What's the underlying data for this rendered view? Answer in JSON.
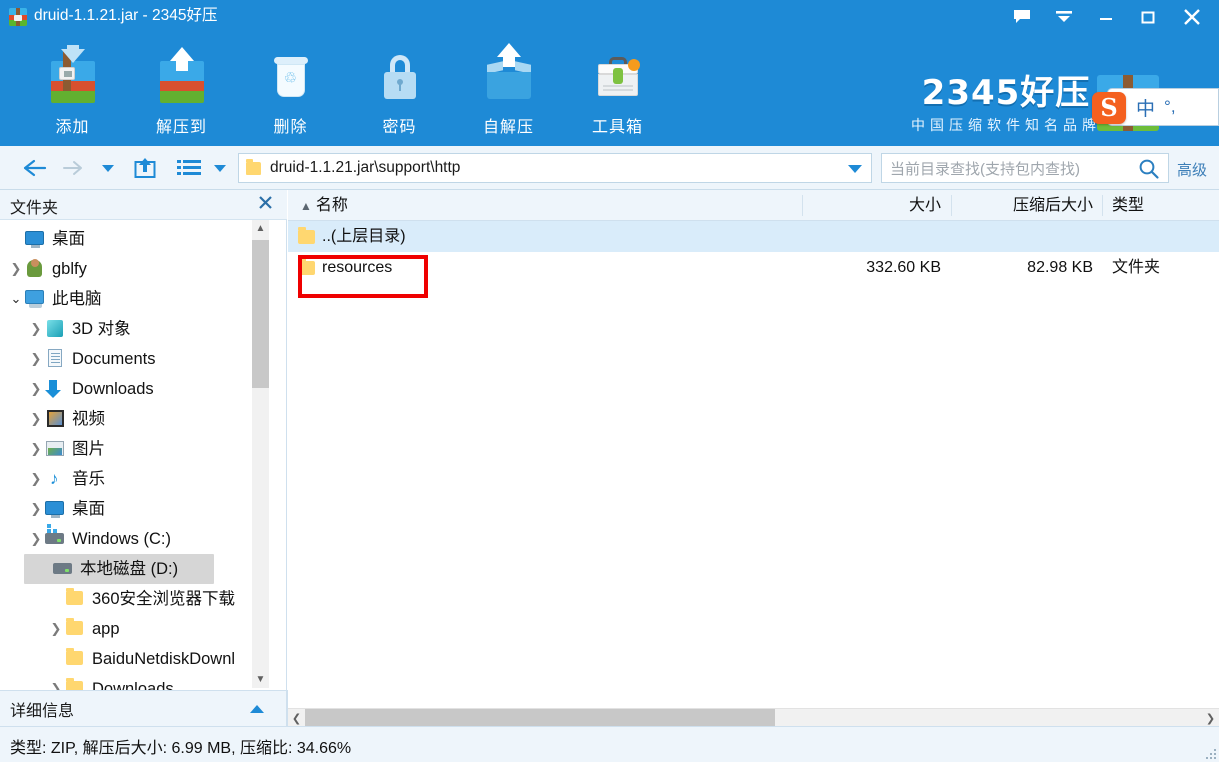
{
  "titlebar": {
    "title": "druid-1.1.21.jar - 2345好压",
    "app_icon": "archive-icon",
    "buttons": [
      {
        "name": "feedback-button",
        "icon": "speech-bubble-icon"
      },
      {
        "name": "menu-dropdown-button",
        "icon": "chevron-down-icon"
      },
      {
        "name": "minimize-button",
        "icon": "minimize-icon"
      },
      {
        "name": "maximize-button",
        "icon": "maximize-icon"
      },
      {
        "name": "close-button",
        "icon": "close-icon"
      }
    ]
  },
  "toolbar": {
    "items": [
      {
        "label": "添加",
        "icon": "add-archive-icon"
      },
      {
        "label": "解压到",
        "icon": "extract-to-icon"
      },
      {
        "label": "删除",
        "icon": "trash-icon"
      },
      {
        "label": "密码",
        "icon": "padlock-icon"
      },
      {
        "label": "自解压",
        "icon": "self-extract-icon"
      },
      {
        "label": "工具箱",
        "icon": "toolbox-icon"
      }
    ],
    "brand_main": "2345好压",
    "brand_sub": "中国压缩软件知名品牌"
  },
  "ime": {
    "logo": "S",
    "mode": "中",
    "punct": "°,"
  },
  "navbar": {
    "back": "back-arrow",
    "forward": "forward-arrow",
    "history": "history-dropdown",
    "up": "up-one-level",
    "views": "view-list",
    "views_dropdown": "view-dropdown",
    "address_path": "druid-1.1.21.jar\\support\\http",
    "search_placeholder": "当前目录查找(支持包内查找)",
    "search_value": "",
    "advanced_label": "高级"
  },
  "left_panel": {
    "title": "文件夹",
    "close_icon": "close-icon",
    "tree": [
      {
        "label": "桌面",
        "indent": 0,
        "expander": "none",
        "icon": "monitor-icon",
        "selected": false
      },
      {
        "label": "gblfy",
        "indent": 0,
        "expander": "collapsed",
        "icon": "user-icon",
        "selected": false
      },
      {
        "label": "此电脑",
        "indent": 0,
        "expander": "expanded",
        "icon": "pc-icon",
        "selected": false
      },
      {
        "label": "3D 对象",
        "indent": 1,
        "expander": "collapsed",
        "icon": "cube-icon",
        "selected": false
      },
      {
        "label": "Documents",
        "indent": 1,
        "expander": "collapsed",
        "icon": "documents-icon",
        "selected": false
      },
      {
        "label": "Downloads",
        "indent": 1,
        "expander": "collapsed",
        "icon": "download-icon",
        "selected": false
      },
      {
        "label": "视频",
        "indent": 1,
        "expander": "collapsed",
        "icon": "video-icon",
        "selected": false
      },
      {
        "label": "图片",
        "indent": 1,
        "expander": "collapsed",
        "icon": "picture-icon",
        "selected": false
      },
      {
        "label": "音乐",
        "indent": 1,
        "expander": "collapsed",
        "icon": "music-icon",
        "selected": false
      },
      {
        "label": "桌面",
        "indent": 1,
        "expander": "collapsed",
        "icon": "monitor-icon",
        "selected": false
      },
      {
        "label": "Windows (C:)",
        "indent": 1,
        "expander": "collapsed",
        "icon": "system-drive-icon",
        "selected": false
      },
      {
        "label": "本地磁盘 (D:)",
        "indent": 1,
        "expander": "expanded",
        "icon": "drive-icon",
        "selected": true
      },
      {
        "label": "360安全浏览器下载",
        "indent": 2,
        "expander": "none",
        "icon": "folder-icon",
        "selected": false
      },
      {
        "label": "app",
        "indent": 2,
        "expander": "collapsed",
        "icon": "folder-icon",
        "selected": false
      },
      {
        "label": "BaiduNetdiskDownl",
        "indent": 2,
        "expander": "none",
        "icon": "folder-icon",
        "selected": false
      },
      {
        "label": "Downloads",
        "indent": 2,
        "expander": "collapsed",
        "icon": "folder-icon",
        "selected": false
      }
    ],
    "details_label": "详细信息",
    "details_toggle_icon": "chevron-up-icon"
  },
  "file_list": {
    "columns": [
      "名称",
      "大小",
      "压缩后大小",
      "类型"
    ],
    "sort_indicator": "▲",
    "rows": [
      {
        "name": "..(上层目录)",
        "size": "",
        "packed": "",
        "type": "",
        "icon": "folder-icon",
        "selected": true,
        "highlighted": false
      },
      {
        "name": "resources",
        "size": "332.60 KB",
        "packed": "82.98 KB",
        "type": "文件夹",
        "icon": "folder-icon",
        "selected": false,
        "highlighted": true
      }
    ],
    "highlight_color": "#ef0000"
  },
  "status_bar": {
    "text": "类型: ZIP, 解压后大小: 6.99 MB, 压缩比: 34.66%"
  },
  "colors": {
    "brand_blue": "#1e8ad6",
    "panel_bg": "#eef5fb",
    "selected_row": "#d9ecfa",
    "tree_selected": "#d6d6d6"
  }
}
